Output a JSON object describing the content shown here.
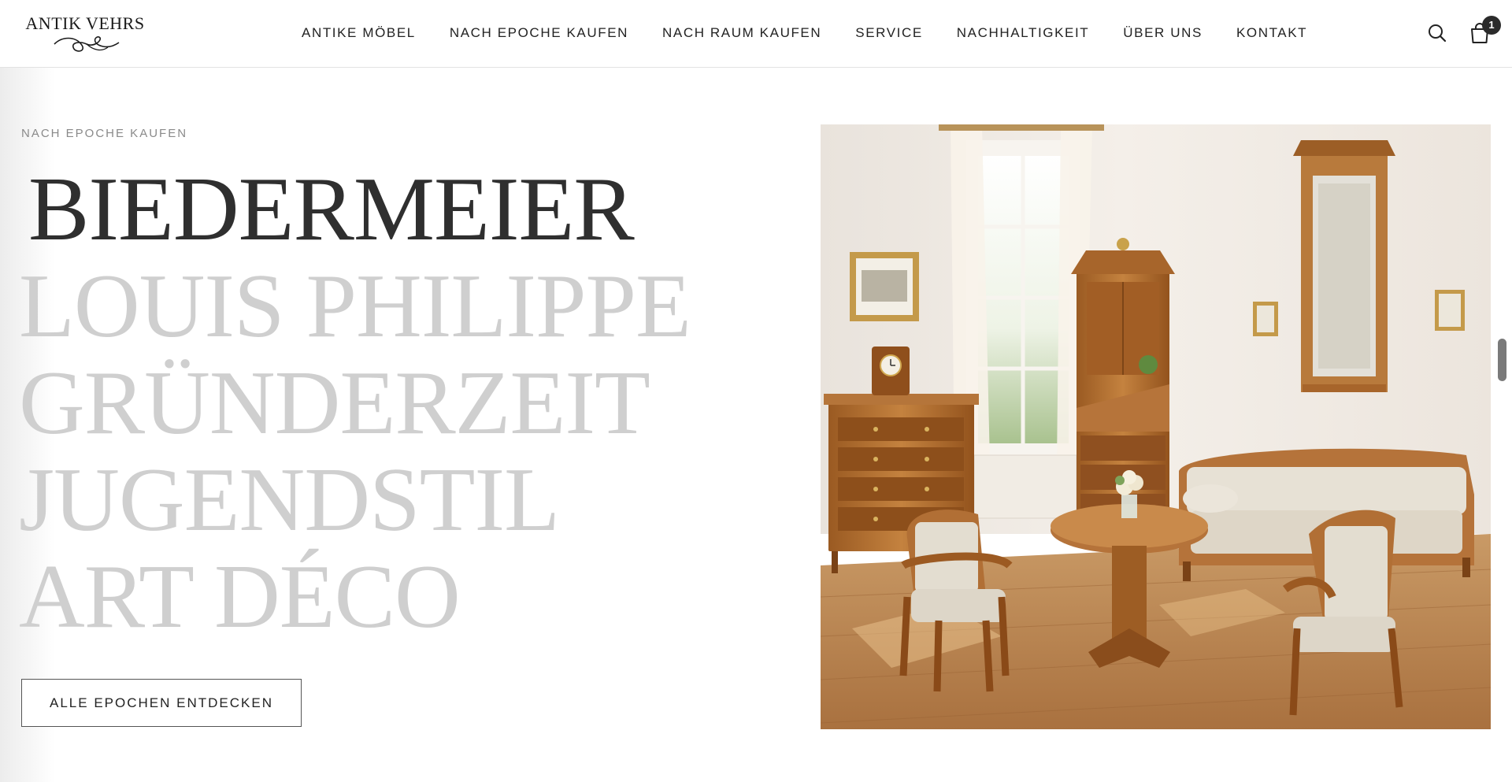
{
  "header": {
    "logo_text": "ANTIK VEHRS",
    "nav": [
      "ANTIKE MÖBEL",
      "NACH EPOCHE KAUFEN",
      "NACH RAUM KAUFEN",
      "SERVICE",
      "NACHHALTIGKEIT",
      "ÜBER UNS",
      "KONTAKT"
    ],
    "cart_count": "1",
    "icons": {
      "search": "search-icon",
      "cart": "shopping-bag-icon"
    }
  },
  "hero": {
    "eyebrow": "NACH EPOCHE KAUFEN",
    "epochs": [
      {
        "label": "BIEDERMEIER",
        "active": true
      },
      {
        "label": "LOUIS PHILIPPE",
        "active": false
      },
      {
        "label": "GRÜNDERZEIT",
        "active": false
      },
      {
        "label": "JUGENDSTIL",
        "active": false
      },
      {
        "label": "ART DÉCO",
        "active": false
      }
    ],
    "cta_label": "ALLE EPOCHEN ENTDECKEN"
  },
  "colors": {
    "text_dark": "#2f2f2f",
    "text_inactive": "#cfcfcf",
    "eyebrow": "#8a8a8a",
    "wood": "#b06a2c",
    "wall": "#efe9e2",
    "floor": "#c68a52"
  }
}
